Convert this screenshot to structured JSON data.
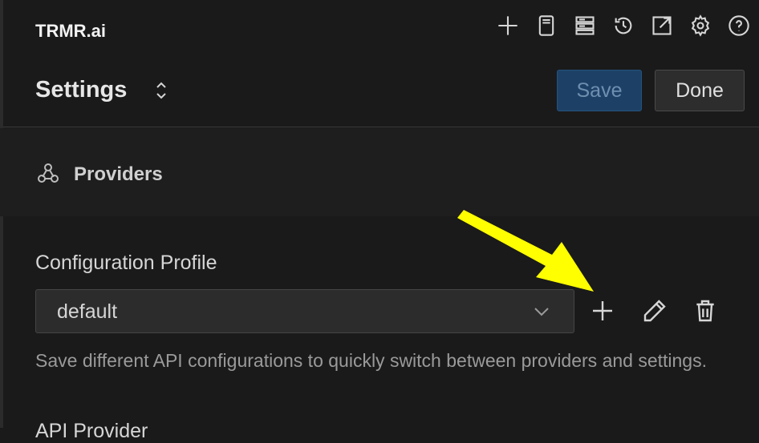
{
  "app": {
    "title": "TRMR.ai"
  },
  "toolbar": {
    "icons": [
      "plus-icon",
      "notebook-icon",
      "server-icon",
      "history-icon",
      "external-link-icon",
      "gear-icon",
      "help-icon"
    ]
  },
  "header": {
    "title": "Settings",
    "save_label": "Save",
    "done_label": "Done"
  },
  "providers": {
    "label": "Providers"
  },
  "config": {
    "label": "Configuration Profile",
    "selected": "default",
    "help": "Save different API configurations to quickly switch between providers and settings."
  },
  "next_section": {
    "label": "API Provider"
  },
  "colors": {
    "background": "#1a1a1a",
    "save_button": "#1d4166",
    "done_button": "#2d2d2d",
    "annotation_arrow": "#ffff00"
  }
}
